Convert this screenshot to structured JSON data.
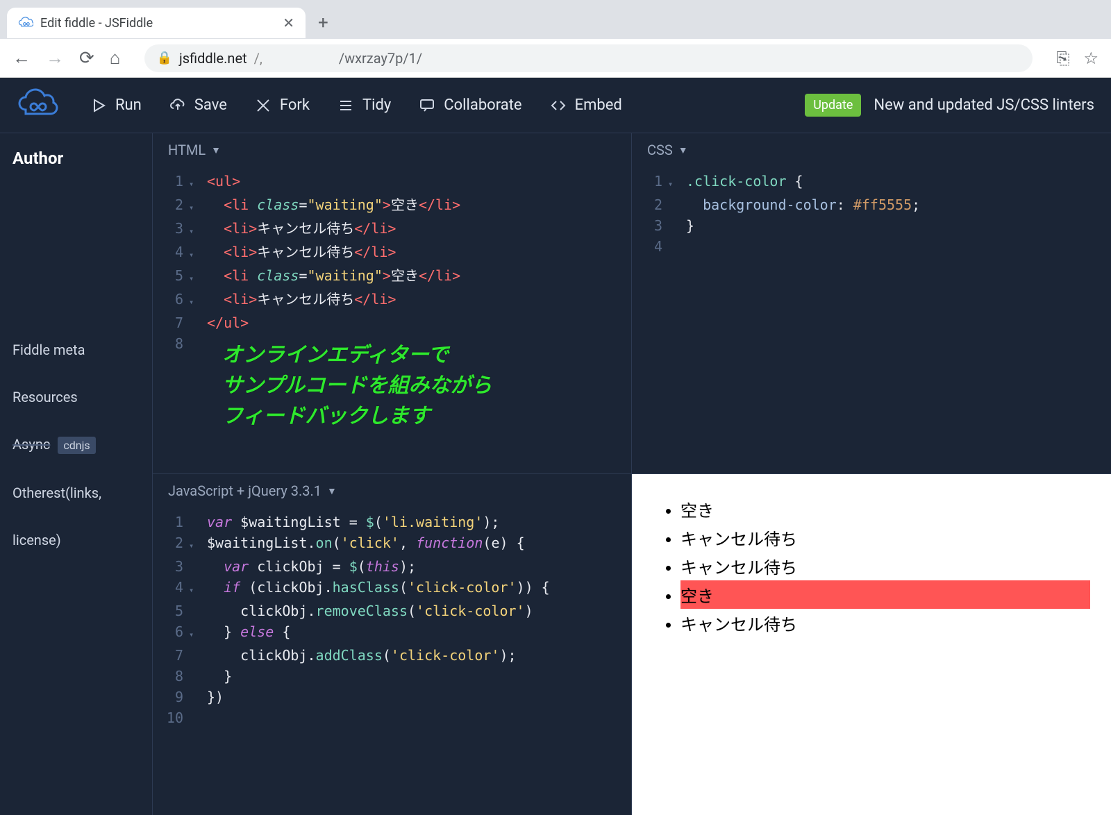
{
  "browser": {
    "tab_title": "Edit fiddle - JSFiddle",
    "url_host": "jsfiddle.net",
    "url_mid": "/,",
    "url_path": "/wxrzay7p/1/"
  },
  "header": {
    "run": "Run",
    "save": "Save",
    "fork": "Fork",
    "tidy": "Tidy",
    "collaborate": "Collaborate",
    "embed": "Embed",
    "update_badge": "Update",
    "linters": "New and updated JS/CSS linters"
  },
  "sidebar": {
    "author": "Author",
    "fiddle_meta": "Fiddle meta",
    "resources": "Resources",
    "async_text": "Async",
    "cdnjs": "cdnjs",
    "other_links": "Otherest(links,",
    "license": "license)"
  },
  "panes": {
    "html_label": "HTML",
    "css_label": "CSS",
    "js_label": "JavaScript + jQuery 3.3.1"
  },
  "html_code": {
    "l1": "<ul>",
    "l2_pre": "  <li ",
    "l2_attr": "class",
    "l2_eq": "=",
    "l2_val": "\"waiting\"",
    "l2_mid": ">",
    "l2_txt": "空き",
    "l2_end": "</li>",
    "l3_pre": "  <li>",
    "l3_txt": "キャンセル待ち",
    "l3_end": "</li>",
    "l4_pre": "  <li>",
    "l4_txt": "キャンセル待ち",
    "l4_end": "</li>",
    "l5_pre": "  <li ",
    "l5_attr": "class",
    "l5_eq": "=",
    "l5_val": "\"waiting\"",
    "l5_mid": ">",
    "l5_txt": "空き",
    "l5_end": "</li>",
    "l6_pre": "  <li>",
    "l6_txt": "キャンセル待ち",
    "l6_end": "</li>",
    "l7": "</ul>"
  },
  "css_code": {
    "l1_sel": ".click-color",
    "l1_brace": " {",
    "l2_prop": "  background-color",
    "l2_colon": ": ",
    "l2_val": "#ff5555",
    "l2_semi": ";",
    "l3": "}"
  },
  "js_code": {
    "l1_kw": "var",
    "l1_sp": " ",
    "l1_var": "$waitingList",
    "l1_eq": " = ",
    "l1_fn": "$",
    "l1_p": "(",
    "l1_str": "'li.waiting'",
    "l1_p2": ");",
    "l2_a": "$waitingList.",
    "l2_on": "on",
    "l2_p": "(",
    "l2_s1": "'click'",
    "l2_c": ", ",
    "l2_fn": "function",
    "l2_p2": "(e) {",
    "l3_kw": "  var",
    "l3_sp": " ",
    "l3_v": "clickObj",
    "l3_eq": " = ",
    "l3_fn": "$",
    "l3_p": "(",
    "l3_this": "this",
    "l3_p2": ");",
    "l4_kw": "  if",
    "l4_sp": " (",
    "l4_v": "clickObj",
    "l4_d": ".",
    "l4_fn": "hasClass",
    "l4_p": "(",
    "l4_s": "'click-color'",
    "l4_p2": ")) {",
    "l5_pre": "    ",
    "l5_v": "clickObj",
    "l5_d": ".",
    "l5_fn": "removeClass",
    "l5_p": "(",
    "l5_s": "'click-color'",
    "l5_p2": ")",
    "l6_pre": "  } ",
    "l6_kw": "else",
    "l6_b": " {",
    "l7_pre": "    ",
    "l7_v": "clickObj",
    "l7_d": ".",
    "l7_fn": "addClass",
    "l7_p": "(",
    "l7_s": "'click-color'",
    "l7_p2": ");",
    "l8": "  }",
    "l9": "})"
  },
  "result": {
    "items": [
      "空き",
      "キャンセル待ち",
      "キャンセル待ち",
      "空き",
      "キャンセル待ち"
    ],
    "highlighted_index": 3
  },
  "overlay": {
    "line1": "オンラインエディターで",
    "line2": "サンプルコードを組みながら",
    "line3": "フィードバックします"
  },
  "lines": {
    "n1": "1",
    "n2": "2",
    "n3": "3",
    "n4": "4",
    "n5": "5",
    "n6": "6",
    "n7": "7",
    "n8": "8",
    "n9": "9",
    "n10": "10"
  }
}
